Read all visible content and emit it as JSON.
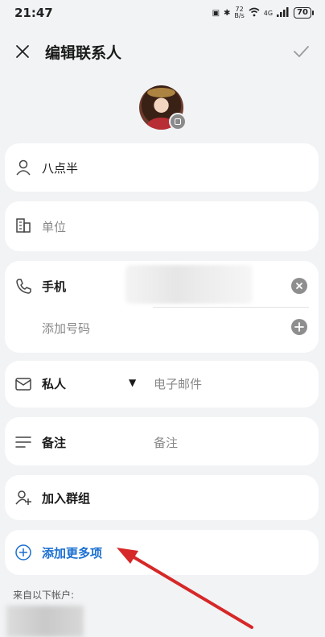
{
  "status_bar": {
    "time": "21:47",
    "net_speed_top": "72",
    "net_speed_bottom": "B/s",
    "signal_label": "4G",
    "battery": "70"
  },
  "header": {
    "title": "编辑联系人",
    "close_icon": "close-icon",
    "confirm_icon": "check-icon"
  },
  "contact": {
    "name": "八点半",
    "company_placeholder": "单位",
    "phone_type": "手机",
    "add_phone_label": "添加号码",
    "email_type": "私人",
    "email_placeholder": "电子邮件",
    "note_label": "备注",
    "note_placeholder": "备注",
    "group_label": "加入群组",
    "add_more_label": "添加更多项",
    "account_source_label": "来自以下帐户:"
  },
  "colors": {
    "accent": "#1a6fd1",
    "arrow": "#d62828",
    "background": "#f1f3f5"
  }
}
